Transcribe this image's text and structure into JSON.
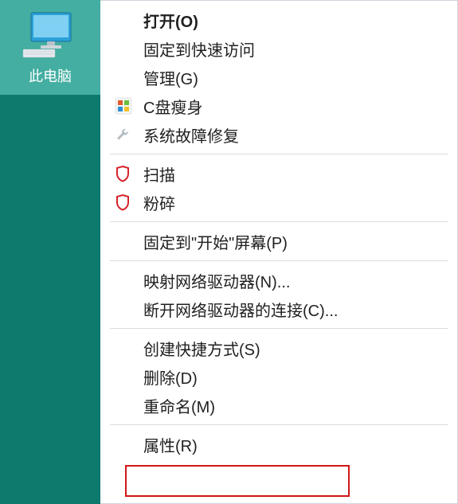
{
  "desktop_icon": {
    "label": "此电脑"
  },
  "menu": {
    "open": "打开(O)",
    "pin_quick_access": "固定到快速访问",
    "manage": "管理(G)",
    "c_drive_slim": "C盘瘦身",
    "system_repair": "系统故障修复",
    "scan": "扫描",
    "shred": "粉碎",
    "pin_start": "固定到\"开始\"屏幕(P)",
    "map_network": "映射网络驱动器(N)...",
    "disconnect_network": "断开网络驱动器的连接(C)...",
    "create_shortcut": "创建快捷方式(S)",
    "delete": "删除(D)",
    "rename": "重命名(M)",
    "properties": "属性(R)"
  },
  "highlight": {
    "target": "properties"
  }
}
